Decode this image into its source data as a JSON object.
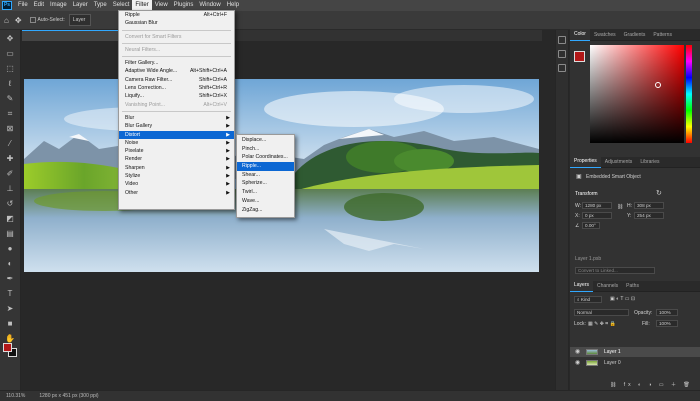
{
  "menubar": {
    "logo": "Ps",
    "items": [
      "File",
      "Edit",
      "Image",
      "Layer",
      "Type",
      "Select",
      "Filter",
      "View",
      "Plugins",
      "Window",
      "Help"
    ],
    "active_index": 6
  },
  "options": {
    "auto_select_label": "Auto-Select:",
    "auto_select_value": "Layer"
  },
  "filter_menu": {
    "items": [
      {
        "label": "Ripple",
        "shortcut": "Alt+Ctrl+F"
      },
      {
        "label": "Gaussian Blur",
        "shortcut": ""
      },
      {
        "sep": true
      },
      {
        "label": "Convert for Smart Filters",
        "shortcut": "",
        "disabled": true
      },
      {
        "sep": true
      },
      {
        "label": "Neural Filters...",
        "shortcut": "",
        "disabled": true
      },
      {
        "sep": true
      },
      {
        "label": "Filter Gallery...",
        "shortcut": ""
      },
      {
        "label": "Adaptive Wide Angle...",
        "shortcut": "Alt+Shift+Ctrl+A"
      },
      {
        "label": "Camera Raw Filter...",
        "shortcut": "Shift+Ctrl+A"
      },
      {
        "label": "Lens Correction...",
        "shortcut": "Shift+Ctrl+R"
      },
      {
        "label": "Liquify...",
        "shortcut": "Shift+Ctrl+X"
      },
      {
        "label": "Vanishing Point...",
        "shortcut": "Alt+Ctrl+V",
        "disabled": true
      },
      {
        "sep": true
      },
      {
        "label": "Blur",
        "submenu": true
      },
      {
        "label": "Blur Gallery",
        "submenu": true
      },
      {
        "label": "Distort",
        "submenu": true,
        "highlighted": true
      },
      {
        "label": "Noise",
        "submenu": true
      },
      {
        "label": "Pixelate",
        "submenu": true
      },
      {
        "label": "Render",
        "submenu": true
      },
      {
        "label": "Sharpen",
        "submenu": true
      },
      {
        "label": "Stylize",
        "submenu": true
      },
      {
        "label": "Video",
        "submenu": true
      },
      {
        "label": "Other",
        "submenu": true
      }
    ]
  },
  "distort_menu": {
    "items": [
      "Displace...",
      "Pinch...",
      "Polar Coordinates...",
      "Ripple...",
      "Shear...",
      "Spherize...",
      "Twirl...",
      "Wave...",
      "ZigZag..."
    ],
    "highlighted_index": 3
  },
  "color_panel": {
    "tabs": [
      "Color",
      "Swatches",
      "Gradients",
      "Patterns"
    ],
    "foreground": "#b31818"
  },
  "properties_panel": {
    "tabs": [
      "Properties",
      "Adjustments",
      "Libraries"
    ],
    "object_type": "Embedded Smart Object",
    "transform_label": "Transform",
    "w_label": "W:",
    "w_value": "1280 px",
    "h_label": "H:",
    "h_value": "308 px",
    "x_label": "X:",
    "x_value": "0 px",
    "y_label": "Y:",
    "y_value": "254 px",
    "angle_value": "0.00°",
    "linked_file": "Layer 1.psb",
    "convert_button": "Convert to Linked..."
  },
  "layers_panel": {
    "tabs": [
      "Layers",
      "Channels",
      "Paths"
    ],
    "kind_filter": "Kind",
    "blend_mode": "Normal",
    "opacity_label": "Opacity:",
    "opacity_value": "100%",
    "lock_label": "Lock:",
    "fill_label": "Fill:",
    "fill_value": "100%",
    "layers": [
      {
        "name": "Layer 1",
        "selected": true
      },
      {
        "name": "Layer 0",
        "selected": false
      }
    ]
  },
  "status": {
    "zoom": "110.31%",
    "doc_info": "1280 px x 451 px (300 ppi)"
  }
}
